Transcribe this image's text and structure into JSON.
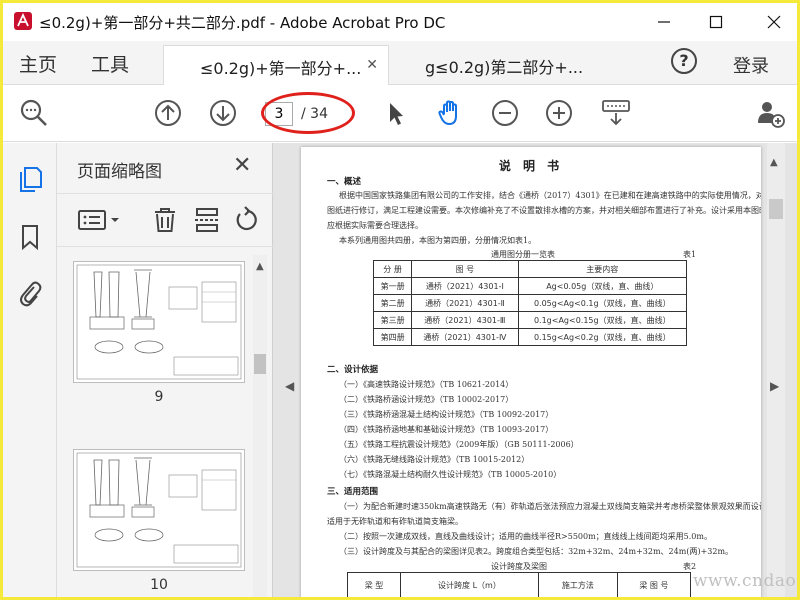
{
  "window": {
    "title": "≤0.2g)+第一部分+共二部分.pdf - Adobe Acrobat Pro DC",
    "minimize": "—",
    "maximize": "☐",
    "close": "✕"
  },
  "menu": {
    "home": "主页",
    "tools": "工具",
    "login": "登录",
    "help": "?"
  },
  "tabs": [
    {
      "label": "≤0.2g)+第一部分+...",
      "close": "✕"
    },
    {
      "label": "g≤0.2g)第二部分+...",
      "close": ""
    }
  ],
  "toolbar": {
    "current_page": "3",
    "page_total": "/ 34",
    "highlight_color": "#e0201b"
  },
  "thumbnail_panel": {
    "title": "页面缩略图",
    "close": "✕",
    "thumbs": [
      {
        "label": "9"
      },
      {
        "label": "10"
      }
    ]
  },
  "document": {
    "title": "说 明 书",
    "sec1": "一、概述",
    "p1": [
      "根据中国国家铁路集团有限公司的工作安排，结合《通桥（2017）4301》在已建和在建高速铁路中的实际使用情况，对",
      "图纸进行修订，满足工程建设需要。本次修编补充了不设置散排水槽的方案，并对相关细部布置进行了补充。设计采用本图时",
      "应根据实际需要合理选择。",
      "本系列通用图共四册，本图为第四册，分册情况如表1。"
    ],
    "table1_caption": "通用图分册一览表",
    "table1_no": "表1",
    "table1_head": [
      "分 册",
      "图 号",
      "主要内容"
    ],
    "table1_rows": [
      [
        "第一册",
        "通桥（2021）4301-Ⅰ",
        "Ag<0.05g（双线，直、曲线）"
      ],
      [
        "第二册",
        "通桥（2021）4301-Ⅱ",
        "0.05g<Ag<0.1g（双线，直、曲线）"
      ],
      [
        "第三册",
        "通桥（2021）4301-Ⅲ",
        "0.1g<Ag<0.15g（双线，直、曲线）"
      ],
      [
        "第四册",
        "通桥（2021）4301-Ⅳ",
        "0.15g<Ag<0.2g（双线，直、曲线）"
      ]
    ],
    "sec2": "二、设计依据",
    "refs": [
      "（一）《高速铁路设计规范》（TB 10621-2014）",
      "（二）《铁路桥涵设计规范》（TB 10002-2017）",
      "（三）《铁路桥涵混凝土结构设计规范》（TB 10092-2017）",
      "（四）《铁路桥涵地基和基础设计规范》（TB 10093-2017）",
      "（五）《铁路工程抗震设计规范》（2009年版）（GB 50111-2006）",
      "（六）《铁路无缝线路设计规范》（TB 10015-2012）",
      "（七）《铁路混凝土结构耐久性设计规范》（TB 10005-2010）"
    ],
    "sec3": "三、适用范围",
    "scope": [
      "（一）为配合新建时速350km高速铁路无（有）砟轨道后张法预应力混凝土双线简支箱梁并考虑桥梁整体景观效果而设计，",
      "适用于无砟轨道和有砟轨道简支箱梁。",
      "（二）按照一次建成双线，直线及曲线设计；适用的曲线半径R>5500m；直线线上线间距均采用5.0m。",
      "（三）设计跨度及与其配合的梁图详见表2。跨度组合类型包括：32m+32m、24m+32m、24m(两)+32m。"
    ],
    "table2_caption": "设计跨度及梁图",
    "table2_no": "表2",
    "table2_head": [
      "梁 型",
      "设计跨度 L（m）",
      "施工方法",
      "梁 图 号"
    ]
  },
  "watermark": "www.cndao.com",
  "colors": {
    "frame_border": "#f5ea3b",
    "accent_blue": "#1473e6"
  }
}
